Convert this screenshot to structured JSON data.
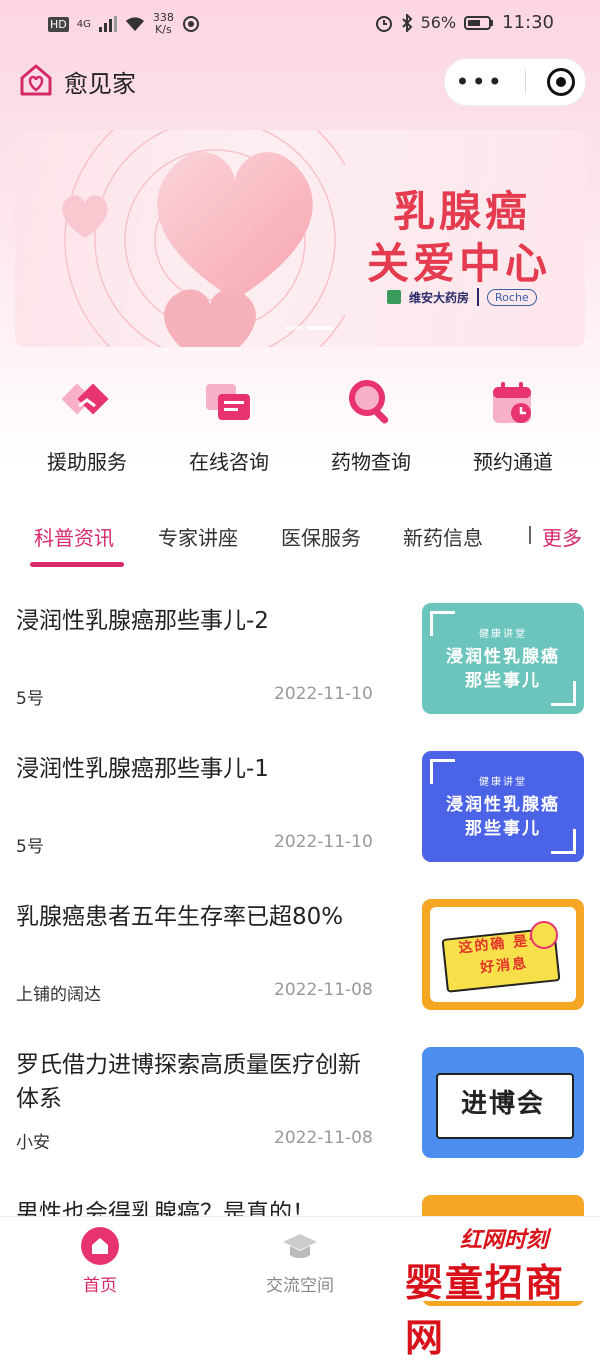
{
  "status_bar": {
    "left_badges": [
      "HD",
      "4G"
    ],
    "speed_value": "338",
    "speed_unit": "K/s",
    "battery": "56%",
    "time": "11:30"
  },
  "app": {
    "title": "愈见家",
    "menu_dots": "•••"
  },
  "banner": {
    "title_line1": "乳腺癌",
    "title_line2": "关爱中心",
    "sponsor1": "维安大药房",
    "sponsor2": "Roche"
  },
  "quick_actions": [
    {
      "label": "援助服务",
      "icon": "handshake-icon"
    },
    {
      "label": "在线咨询",
      "icon": "chat-icon"
    },
    {
      "label": "药物查询",
      "icon": "search-icon"
    },
    {
      "label": "预约通道",
      "icon": "calendar-icon"
    }
  ],
  "tabs": {
    "items": [
      "科普资讯",
      "专家讲座",
      "医保服务",
      "新药信息"
    ],
    "active_index": 0,
    "more": "更多"
  },
  "news": [
    {
      "title": "浸润性乳腺癌那些事儿-2",
      "author": "5号",
      "date": "2022-11-10",
      "thumb_text": "浸润性乳腺癌 那些事儿",
      "thumb_color": "#6cc5bd"
    },
    {
      "title": "浸润性乳腺癌那些事儿-1",
      "author": "5号",
      "date": "2022-11-10",
      "thumb_text": "浸润性乳腺癌 那些事儿",
      "thumb_color": "#4b63e6"
    },
    {
      "title": "乳腺癌患者五年生存率已超80%",
      "author": "上铺的阔达",
      "date": "2022-11-08",
      "thumb_text": "这的确 是个好消息",
      "thumb_color": "#f5a623"
    },
    {
      "title": "罗氏借力进博探索高质量医疗创新体系",
      "author": "小安",
      "date": "2022-11-08",
      "thumb_text": "进博会",
      "thumb_color": "#4c8ef0"
    },
    {
      "title": "男性也会得乳腺癌？是真的！",
      "author": "",
      "date": "",
      "thumb_text": "",
      "thumb_color": "#f5a623"
    }
  ],
  "thumb_badge": "健康讲堂",
  "bottom_nav": [
    {
      "label": "首页",
      "active": true
    },
    {
      "label": "交流空间",
      "active": false
    }
  ],
  "watermark": {
    "line1": "红网时刻",
    "line2": "婴童招商网"
  },
  "colors": {
    "accent": "#d62a6a",
    "banner_title": "#e53b4f"
  }
}
